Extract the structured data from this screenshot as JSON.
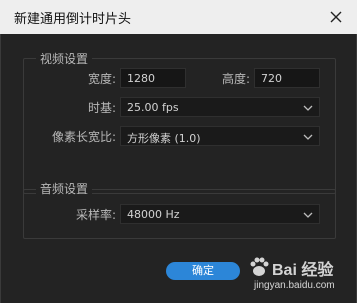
{
  "window": {
    "title": "新建通用倒计时片头"
  },
  "video_settings": {
    "section_label": "视频设置",
    "width_label": "宽度:",
    "width_value": "1280",
    "height_label": "高度:",
    "height_value": "720",
    "timebase_label": "时基:",
    "timebase_value": "25.00 fps",
    "pixel_aspect_label": "像素长宽比:",
    "pixel_aspect_value": "方形像素 (1.0)"
  },
  "audio_settings": {
    "section_label": "音频设置",
    "sample_rate_label": "采样率:",
    "sample_rate_value": "48000 Hz"
  },
  "buttons": {
    "ok_label": "确定"
  },
  "watermark": {
    "brand": "Bai 经验",
    "url": "jingyan.baidu.com"
  },
  "colors": {
    "accent": "#2c86d8",
    "panel": "#232323",
    "titlebar": "#eeeeee"
  }
}
